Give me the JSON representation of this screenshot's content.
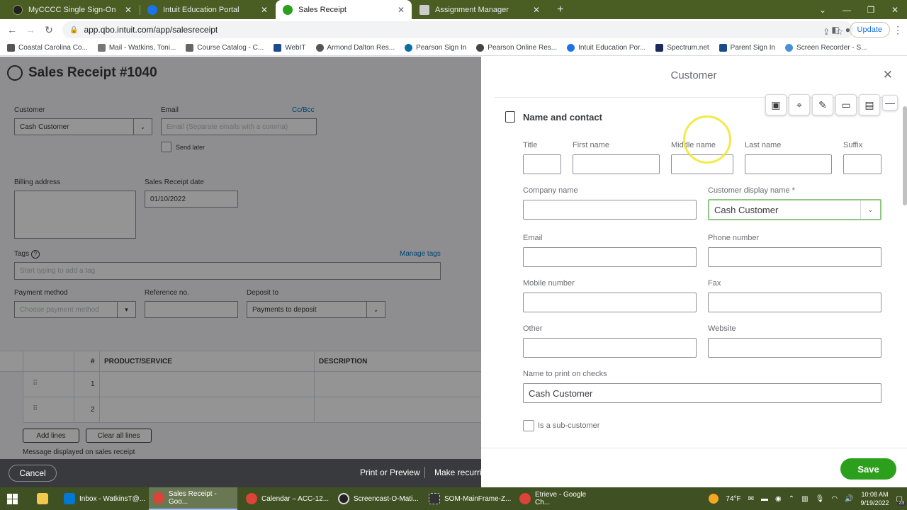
{
  "browser": {
    "tabs": [
      {
        "label": "MyCCCC Single Sign-On",
        "color": "#333333"
      },
      {
        "label": "Intuit Education Portal",
        "color": "#1a73e8"
      },
      {
        "label": "Sales Receipt",
        "color": "#2ca01c"
      },
      {
        "label": "Assignment Manager",
        "color": "#666666"
      }
    ],
    "new_tab": "+",
    "url": "app.qbo.intuit.com/app/salesreceipt",
    "update_label": "Update",
    "bookmarks": [
      "Coastal Carolina Co...",
      "Mail - Watkins, Toni...",
      "Course Catalog - C...",
      "WebIT",
      "Armond Dalton Res...",
      "Pearson Sign In",
      "Pearson Online Res...",
      "Intuit Education Por...",
      "Spectrum.net",
      "Parent Sign In",
      "Screen Recorder - S..."
    ]
  },
  "sales_receipt": {
    "title": "Sales Receipt #1040",
    "customer_label": "Customer",
    "customer_value": "Cash Customer",
    "email_label": "Email",
    "email_placeholder": "Email (Separate emails with a comma)",
    "ccbcc": "Cc/Bcc",
    "send_later": "Send later",
    "billing_label": "Billing address",
    "date_label": "Sales Receipt date",
    "date_value": "01/10/2022",
    "tags_label": "Tags",
    "manage_tags": "Manage tags",
    "tags_placeholder": "Start typing to add a tag",
    "payment_label": "Payment method",
    "payment_placeholder": "Choose payment method",
    "ref_label": "Reference no.",
    "deposit_label": "Deposit to",
    "deposit_value": "Payments to deposit",
    "col_num": "#",
    "col_product": "PRODUCT/SERVICE",
    "col_description": "DESCRIPTION",
    "rows": [
      "1",
      "2"
    ],
    "add_lines": "Add lines",
    "clear_lines": "Clear all lines",
    "message_label": "Message displayed on sales receipt",
    "cancel": "Cancel",
    "print_preview": "Print or Preview",
    "make_recurring": "Make recurri"
  },
  "customer_panel": {
    "title": "Customer",
    "section": "Name and contact",
    "title_label": "Title",
    "first_label": "First name",
    "middle_label": "Middle name",
    "last_label": "Last name",
    "suffix_label": "Suffix",
    "company_label": "Company name",
    "display_label": "Customer display name *",
    "display_value": "Cash Customer",
    "email_label": "Email",
    "phone_label": "Phone number",
    "mobile_label": "Mobile number",
    "fax_label": "Fax",
    "other_label": "Other",
    "website_label": "Website",
    "checks_label": "Name to print on checks",
    "checks_value": "Cash Customer",
    "subcustomer_label": "Is a sub-customer",
    "save": "Save"
  },
  "taskbar": {
    "items": [
      "Inbox - WatkinsT@...",
      "Sales Receipt - Goo...",
      "Calendar – ACC-12...",
      "Screencast-O-Mati...",
      "SOM-MainFrame-Z...",
      "Etrieve - Google Ch..."
    ],
    "weather": "74°F",
    "time": "10:08 AM",
    "date": "9/19/2022",
    "badge": "23"
  }
}
